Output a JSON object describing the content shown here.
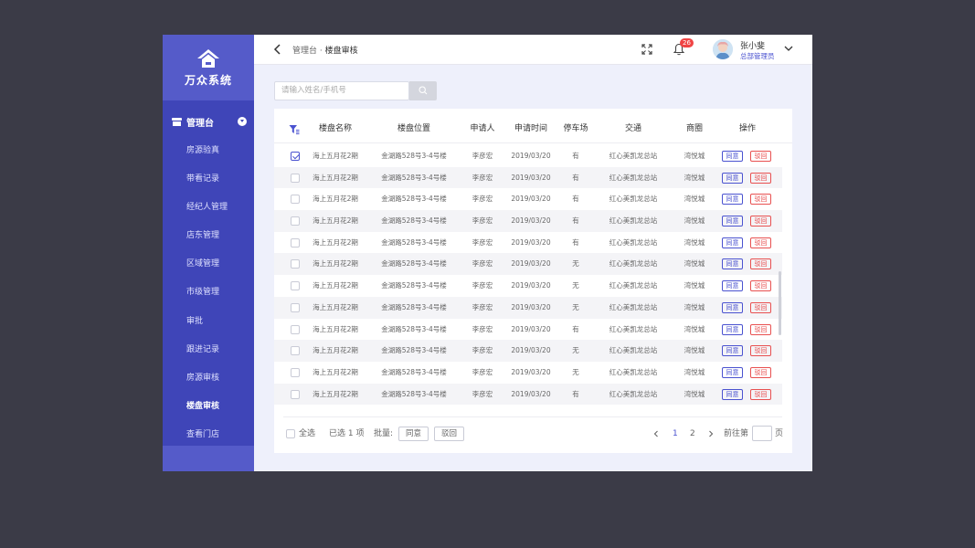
{
  "sidebar": {
    "brand": "万众系统",
    "group_label": "管理台",
    "items": [
      {
        "label": "房源验真"
      },
      {
        "label": "带看记录"
      },
      {
        "label": "经纪人管理"
      },
      {
        "label": "店东管理"
      },
      {
        "label": "区域管理"
      },
      {
        "label": "市级管理"
      },
      {
        "label": "审批"
      },
      {
        "label": "跟进记录"
      },
      {
        "label": "房源审核"
      },
      {
        "label": "楼盘审核"
      },
      {
        "label": "查看门店"
      }
    ],
    "active": "楼盘审核"
  },
  "header": {
    "breadcrumb_root": "管理台",
    "breadcrumb_sep": " · ",
    "breadcrumb_current": "楼盘审核",
    "notification_count": "26",
    "user_name": "张小斐",
    "user_role": "总部管理员"
  },
  "search": {
    "placeholder": "请输入姓名/手机号"
  },
  "table": {
    "columns": [
      "楼盘名称",
      "楼盘位置",
      "申请人",
      "申请时间",
      "停车场",
      "交通",
      "商圈",
      "操作"
    ],
    "agree_label": "同意",
    "reject_label": "驳回",
    "rows": [
      {
        "name": "海上五月花2期",
        "location": "金湖路528号3-4号楼",
        "applicant": "李彦宏",
        "date": "2019/03/20",
        "parking": "有",
        "traffic": "红心美凯龙总站",
        "district": "湾悦城",
        "checked": true
      },
      {
        "name": "海上五月花2期",
        "location": "金湖路528号3-4号楼",
        "applicant": "李彦宏",
        "date": "2019/03/20",
        "parking": "有",
        "traffic": "红心美凯龙总站",
        "district": "湾悦城",
        "checked": false
      },
      {
        "name": "海上五月花2期",
        "location": "金湖路528号3-4号楼",
        "applicant": "李彦宏",
        "date": "2019/03/20",
        "parking": "有",
        "traffic": "红心美凯龙总站",
        "district": "湾悦城",
        "checked": false
      },
      {
        "name": "海上五月花2期",
        "location": "金湖路528号3-4号楼",
        "applicant": "李彦宏",
        "date": "2019/03/20",
        "parking": "有",
        "traffic": "红心美凯龙总站",
        "district": "湾悦城",
        "checked": false
      },
      {
        "name": "海上五月花2期",
        "location": "金湖路528号3-4号楼",
        "applicant": "李彦宏",
        "date": "2019/03/20",
        "parking": "有",
        "traffic": "红心美凯龙总站",
        "district": "湾悦城",
        "checked": false
      },
      {
        "name": "海上五月花2期",
        "location": "金湖路528号3-4号楼",
        "applicant": "李彦宏",
        "date": "2019/03/20",
        "parking": "无",
        "traffic": "红心美凯龙总站",
        "district": "湾悦城",
        "checked": false
      },
      {
        "name": "海上五月花2期",
        "location": "金湖路528号3-4号楼",
        "applicant": "李彦宏",
        "date": "2019/03/20",
        "parking": "无",
        "traffic": "红心美凯龙总站",
        "district": "湾悦城",
        "checked": false
      },
      {
        "name": "海上五月花2期",
        "location": "金湖路528号3-4号楼",
        "applicant": "李彦宏",
        "date": "2019/03/20",
        "parking": "无",
        "traffic": "红心美凯龙总站",
        "district": "湾悦城",
        "checked": false
      },
      {
        "name": "海上五月花2期",
        "location": "金湖路528号3-4号楼",
        "applicant": "李彦宏",
        "date": "2019/03/20",
        "parking": "有",
        "traffic": "红心美凯龙总站",
        "district": "湾悦城",
        "checked": false
      },
      {
        "name": "海上五月花2期",
        "location": "金湖路528号3-4号楼",
        "applicant": "李彦宏",
        "date": "2019/03/20",
        "parking": "无",
        "traffic": "红心美凯龙总站",
        "district": "湾悦城",
        "checked": false
      },
      {
        "name": "海上五月花2期",
        "location": "金湖路528号3-4号楼",
        "applicant": "李彦宏",
        "date": "2019/03/20",
        "parking": "无",
        "traffic": "红心美凯龙总站",
        "district": "湾悦城",
        "checked": false
      },
      {
        "name": "海上五月花2期",
        "location": "金湖路528号3-4号楼",
        "applicant": "李彦宏",
        "date": "2019/03/20",
        "parking": "有",
        "traffic": "红心美凯龙总站",
        "district": "湾悦城",
        "checked": false
      }
    ]
  },
  "footer": {
    "select_all": "全选",
    "selected_prefix": "已选",
    "selected_count": "1",
    "selected_suffix": "项",
    "batch_label": "批量:",
    "batch_agree": "同意",
    "batch_reject": "驳回",
    "pages": [
      "1",
      "2"
    ],
    "current_page": "1",
    "goto_label": "前往第",
    "goto_suffix": "页"
  },
  "colors": {
    "primary": "#4a52d0",
    "sidebar": "#3f45b8",
    "danger": "#e85050",
    "backdrop": "#3b3b47"
  }
}
